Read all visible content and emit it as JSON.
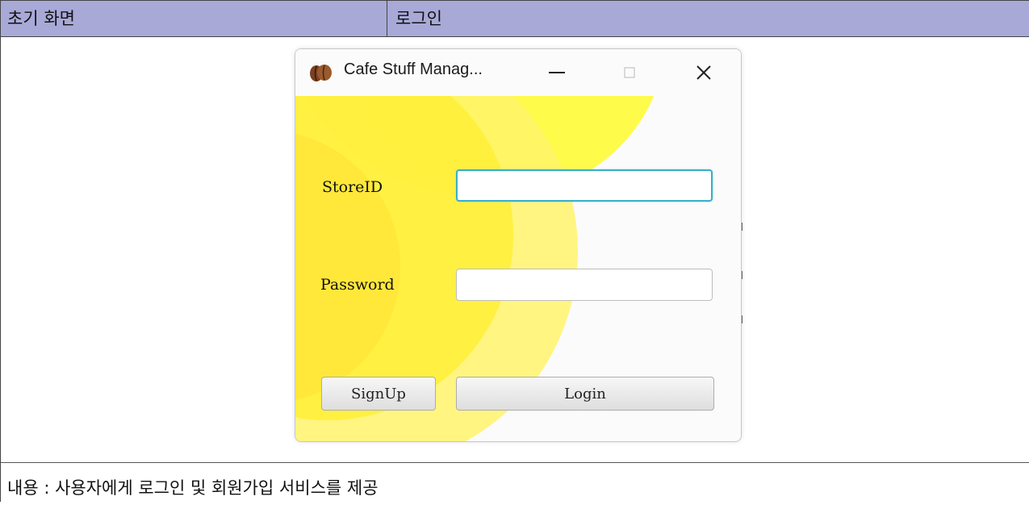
{
  "doc": {
    "header_left": "초기 화면",
    "header_right": "로그인",
    "description": "내용 : 사용자에게 로그인 및 회원가입 서비스를 제공"
  },
  "window": {
    "title": "Cafe Stuff Manag...",
    "icon": "coffee-bean-icon",
    "controls": {
      "minimize": "minimize-icon",
      "maximize": "maximize-icon",
      "close": "close-icon"
    }
  },
  "form": {
    "store_id_label": "StoreID",
    "store_id_value": "",
    "password_label": "Password",
    "password_value": "",
    "signup_label": "SignUp",
    "login_label": "Login"
  },
  "colors": {
    "header_bg": "#a9a9d8",
    "focus_border": "#38b0c8",
    "art_yellow_light": "#fff85a",
    "art_yellow_mid": "#ffef3a",
    "art_yellow_pale": "#fff7a8"
  }
}
